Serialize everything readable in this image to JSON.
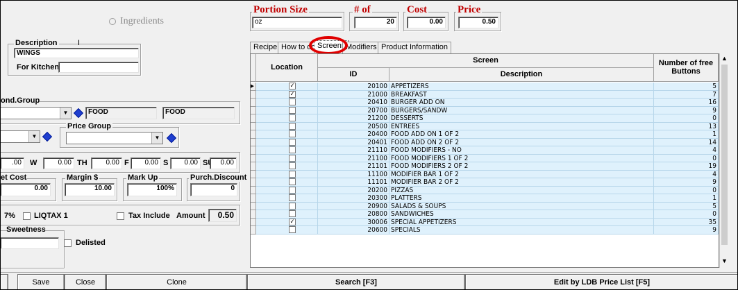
{
  "top": {
    "ingredients_label": "Ingredients",
    "portion_size": {
      "title": "Portion Size",
      "value": "oz"
    },
    "num_of": {
      "title": "# of",
      "value": "20"
    },
    "cost": {
      "title": "Cost",
      "value": "0.00"
    },
    "price": {
      "title": "Price",
      "value": "0.50"
    }
  },
  "left": {
    "description_label": "Description",
    "description_value": "WINGS",
    "for_kitchen_label": "For Kitchen",
    "for_kitchen_value": "",
    "cond_group_label": "ond.Group",
    "cond_group_field1": "FOOD",
    "cond_group_field2": "FOOD",
    "price_group_label": "Price Group",
    "days": [
      {
        "value": ".00",
        "label": "W"
      },
      {
        "value": "0.00",
        "label": "TH"
      },
      {
        "value": "0.00",
        "label": "F"
      },
      {
        "value": "0.00",
        "label": "S"
      },
      {
        "value": "0.00",
        "label": "SU"
      },
      {
        "value": "0.00",
        "label": ""
      }
    ],
    "net_cost_label": "et Cost",
    "net_cost_value": "0.00",
    "margin_label": "Margin $",
    "margin_value": "10.00",
    "markup_label": "Mark Up",
    "markup_value": "100%",
    "purch_discount_label": "Purch.Discount",
    "purch_discount_value": "0",
    "tax_7_label": "7%",
    "liqtax_label": "LIQTAX 1",
    "tax_include_label": "Tax Include",
    "amount_label": "Amount",
    "amount_value": "0.50",
    "sweetness_label": "Sweetness",
    "delisted_label": "Delisted"
  },
  "tabs": [
    {
      "label": "Recipe"
    },
    {
      "label": "How to do"
    },
    {
      "label": "Screens"
    },
    {
      "label": "Modifiers"
    },
    {
      "label": "Product Information"
    }
  ],
  "grid": {
    "headers": {
      "location": "Location",
      "screen": "Screen",
      "id": "ID",
      "description": "Description",
      "free_buttons": "Number of free Buttons"
    },
    "rows": [
      {
        "checked": true,
        "id": "20100",
        "description": "APPETIZERS",
        "buttons": "5"
      },
      {
        "checked": true,
        "id": "21000",
        "description": "BREAKFAST",
        "buttons": "7"
      },
      {
        "checked": false,
        "id": "20410",
        "description": "BURGER ADD ON",
        "buttons": "16"
      },
      {
        "checked": false,
        "id": "20700",
        "description": "BURGERS/SANDW",
        "buttons": "9"
      },
      {
        "checked": false,
        "id": "21200",
        "description": "DESSERTS",
        "buttons": "0"
      },
      {
        "checked": false,
        "id": "20500",
        "description": "ENTREES",
        "buttons": "13"
      },
      {
        "checked": false,
        "id": "20400",
        "description": "FOOD ADD ON 1 OF 2",
        "buttons": "1"
      },
      {
        "checked": false,
        "id": "20401",
        "description": "FOOD ADD ON 2 OF 2",
        "buttons": "14"
      },
      {
        "checked": false,
        "id": "21110",
        "description": "FOOD MODIFIERS - NO",
        "buttons": "4"
      },
      {
        "checked": false,
        "id": "21100",
        "description": "FOOD MODIFIERS 1 OF 2",
        "buttons": "0"
      },
      {
        "checked": false,
        "id": "21101",
        "description": "FOOD MODIFIERS 2 OF 2",
        "buttons": "19"
      },
      {
        "checked": false,
        "id": "11100",
        "description": "MODIFIER BAR 1 OF 2",
        "buttons": "4"
      },
      {
        "checked": false,
        "id": "11101",
        "description": "MODIFIER BAR 2 OF 2",
        "buttons": "9"
      },
      {
        "checked": false,
        "id": "20200",
        "description": "PIZZAS",
        "buttons": "0"
      },
      {
        "checked": false,
        "id": "20300",
        "description": "PLATTERS",
        "buttons": "1"
      },
      {
        "checked": false,
        "id": "20900",
        "description": "SALADS & SOUPS",
        "buttons": "5"
      },
      {
        "checked": false,
        "id": "20800",
        "description": "SANDWICHES",
        "buttons": "0"
      },
      {
        "checked": true,
        "id": "30006",
        "description": "SPECIAL APPETIZERS",
        "buttons": "35"
      },
      {
        "checked": false,
        "id": "20600",
        "description": "SPECIALS",
        "buttons": "9"
      }
    ]
  },
  "bottom": {
    "save": "Save",
    "close": "Close",
    "clone": "Clone",
    "search": "Search [F3]",
    "edit_ldb": "Edit by LDB Price List [F5]"
  },
  "colors": {
    "accent_red": "#c00000",
    "highlight_circle": "#e00000",
    "grid_cell": "#dff1fc"
  }
}
